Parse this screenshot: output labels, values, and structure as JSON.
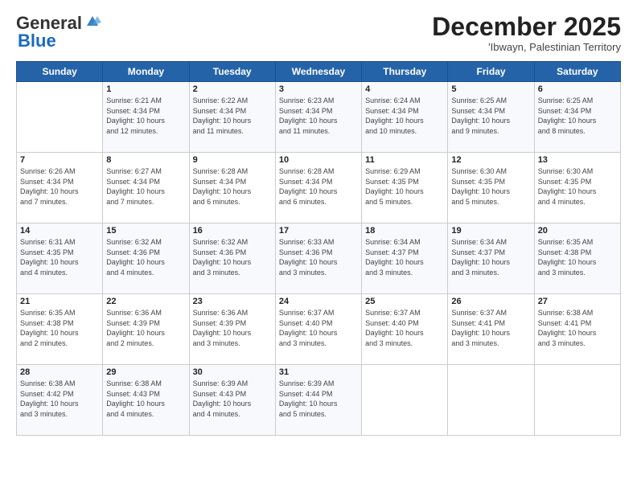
{
  "logo": {
    "general": "General",
    "blue": "Blue"
  },
  "title": "December 2025",
  "subtitle": "'Ibwayn, Palestinian Territory",
  "days_header": [
    "Sunday",
    "Monday",
    "Tuesday",
    "Wednesday",
    "Thursday",
    "Friday",
    "Saturday"
  ],
  "weeks": [
    [
      {
        "day": "",
        "info": ""
      },
      {
        "day": "1",
        "info": "Sunrise: 6:21 AM\nSunset: 4:34 PM\nDaylight: 10 hours\nand 12 minutes."
      },
      {
        "day": "2",
        "info": "Sunrise: 6:22 AM\nSunset: 4:34 PM\nDaylight: 10 hours\nand 11 minutes."
      },
      {
        "day": "3",
        "info": "Sunrise: 6:23 AM\nSunset: 4:34 PM\nDaylight: 10 hours\nand 11 minutes."
      },
      {
        "day": "4",
        "info": "Sunrise: 6:24 AM\nSunset: 4:34 PM\nDaylight: 10 hours\nand 10 minutes."
      },
      {
        "day": "5",
        "info": "Sunrise: 6:25 AM\nSunset: 4:34 PM\nDaylight: 10 hours\nand 9 minutes."
      },
      {
        "day": "6",
        "info": "Sunrise: 6:25 AM\nSunset: 4:34 PM\nDaylight: 10 hours\nand 8 minutes."
      }
    ],
    [
      {
        "day": "7",
        "info": "Sunrise: 6:26 AM\nSunset: 4:34 PM\nDaylight: 10 hours\nand 7 minutes."
      },
      {
        "day": "8",
        "info": "Sunrise: 6:27 AM\nSunset: 4:34 PM\nDaylight: 10 hours\nand 7 minutes."
      },
      {
        "day": "9",
        "info": "Sunrise: 6:28 AM\nSunset: 4:34 PM\nDaylight: 10 hours\nand 6 minutes."
      },
      {
        "day": "10",
        "info": "Sunrise: 6:28 AM\nSunset: 4:34 PM\nDaylight: 10 hours\nand 6 minutes."
      },
      {
        "day": "11",
        "info": "Sunrise: 6:29 AM\nSunset: 4:35 PM\nDaylight: 10 hours\nand 5 minutes."
      },
      {
        "day": "12",
        "info": "Sunrise: 6:30 AM\nSunset: 4:35 PM\nDaylight: 10 hours\nand 5 minutes."
      },
      {
        "day": "13",
        "info": "Sunrise: 6:30 AM\nSunset: 4:35 PM\nDaylight: 10 hours\nand 4 minutes."
      }
    ],
    [
      {
        "day": "14",
        "info": "Sunrise: 6:31 AM\nSunset: 4:35 PM\nDaylight: 10 hours\nand 4 minutes."
      },
      {
        "day": "15",
        "info": "Sunrise: 6:32 AM\nSunset: 4:36 PM\nDaylight: 10 hours\nand 4 minutes."
      },
      {
        "day": "16",
        "info": "Sunrise: 6:32 AM\nSunset: 4:36 PM\nDaylight: 10 hours\nand 3 minutes."
      },
      {
        "day": "17",
        "info": "Sunrise: 6:33 AM\nSunset: 4:36 PM\nDaylight: 10 hours\nand 3 minutes."
      },
      {
        "day": "18",
        "info": "Sunrise: 6:34 AM\nSunset: 4:37 PM\nDaylight: 10 hours\nand 3 minutes."
      },
      {
        "day": "19",
        "info": "Sunrise: 6:34 AM\nSunset: 4:37 PM\nDaylight: 10 hours\nand 3 minutes."
      },
      {
        "day": "20",
        "info": "Sunrise: 6:35 AM\nSunset: 4:38 PM\nDaylight: 10 hours\nand 3 minutes."
      }
    ],
    [
      {
        "day": "21",
        "info": "Sunrise: 6:35 AM\nSunset: 4:38 PM\nDaylight: 10 hours\nand 2 minutes."
      },
      {
        "day": "22",
        "info": "Sunrise: 6:36 AM\nSunset: 4:39 PM\nDaylight: 10 hours\nand 2 minutes."
      },
      {
        "day": "23",
        "info": "Sunrise: 6:36 AM\nSunset: 4:39 PM\nDaylight: 10 hours\nand 3 minutes."
      },
      {
        "day": "24",
        "info": "Sunrise: 6:37 AM\nSunset: 4:40 PM\nDaylight: 10 hours\nand 3 minutes."
      },
      {
        "day": "25",
        "info": "Sunrise: 6:37 AM\nSunset: 4:40 PM\nDaylight: 10 hours\nand 3 minutes."
      },
      {
        "day": "26",
        "info": "Sunrise: 6:37 AM\nSunset: 4:41 PM\nDaylight: 10 hours\nand 3 minutes."
      },
      {
        "day": "27",
        "info": "Sunrise: 6:38 AM\nSunset: 4:41 PM\nDaylight: 10 hours\nand 3 minutes."
      }
    ],
    [
      {
        "day": "28",
        "info": "Sunrise: 6:38 AM\nSunset: 4:42 PM\nDaylight: 10 hours\nand 3 minutes."
      },
      {
        "day": "29",
        "info": "Sunrise: 6:38 AM\nSunset: 4:43 PM\nDaylight: 10 hours\nand 4 minutes."
      },
      {
        "day": "30",
        "info": "Sunrise: 6:39 AM\nSunset: 4:43 PM\nDaylight: 10 hours\nand 4 minutes."
      },
      {
        "day": "31",
        "info": "Sunrise: 6:39 AM\nSunset: 4:44 PM\nDaylight: 10 hours\nand 5 minutes."
      },
      {
        "day": "",
        "info": ""
      },
      {
        "day": "",
        "info": ""
      },
      {
        "day": "",
        "info": ""
      }
    ]
  ]
}
